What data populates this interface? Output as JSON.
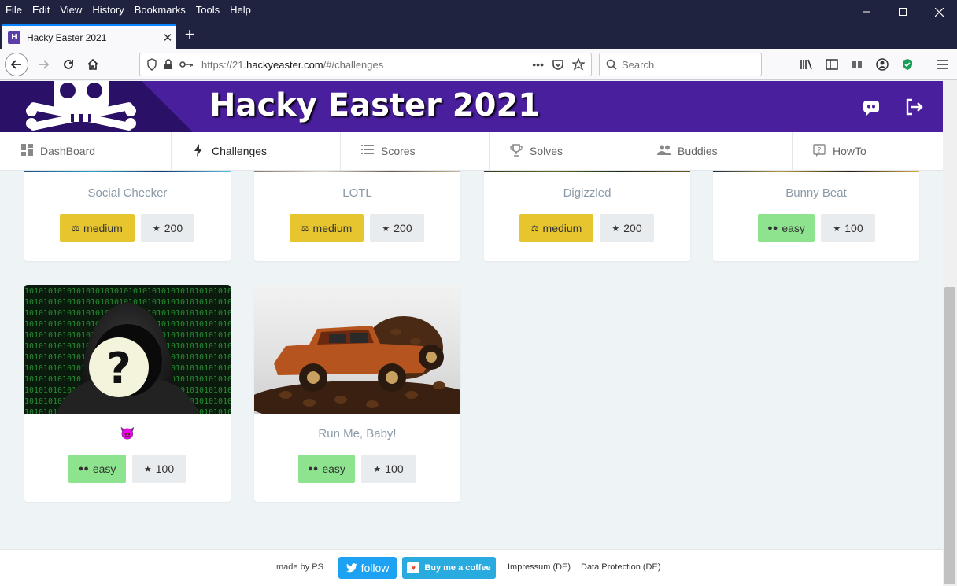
{
  "browser": {
    "menu": [
      "File",
      "Edit",
      "View",
      "History",
      "Bookmarks",
      "Tools",
      "Help"
    ],
    "tab_title": "Hacky Easter 2021",
    "url_prefix": "https://21.",
    "url_domain": "hackyeaster.com",
    "url_suffix": "/#/challenges",
    "search_placeholder": "Search"
  },
  "site": {
    "title": "Hacky Easter 2021",
    "nav": [
      {
        "label": "DashBoard",
        "icon": "dashboard-icon"
      },
      {
        "label": "Challenges",
        "icon": "bolt-icon"
      },
      {
        "label": "Scores",
        "icon": "list-icon"
      },
      {
        "label": "Solves",
        "icon": "trophy-icon"
      },
      {
        "label": "Buddies",
        "icon": "users-icon"
      },
      {
        "label": "HowTo",
        "icon": "question-icon"
      }
    ]
  },
  "challenges": [
    {
      "title": "Social Checker",
      "difficulty": "medium",
      "points": "200"
    },
    {
      "title": "LOTL",
      "difficulty": "medium",
      "points": "200"
    },
    {
      "title": "Digizzled",
      "difficulty": "medium",
      "points": "200"
    },
    {
      "title": "Bunny Beat",
      "difficulty": "easy",
      "points": "100"
    },
    {
      "title": "😈",
      "difficulty": "easy",
      "points": "100"
    },
    {
      "title": "Run Me, Baby!",
      "difficulty": "easy",
      "points": "100"
    }
  ],
  "colors": {
    "header": "#4a1f9e",
    "medium": "#e6c52e",
    "easy": "#8ee48e",
    "points": "#e9ecee"
  },
  "footer": {
    "made_by": "made by PS",
    "follow": "follow",
    "coffee": "Buy me a coffee",
    "impressum": "Impressum (DE)",
    "data_protection": "Data Protection (DE)"
  }
}
